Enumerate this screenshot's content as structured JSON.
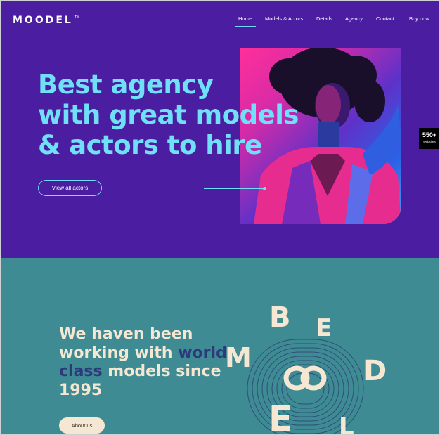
{
  "brand": {
    "logo_text": "MOODEL",
    "logo_mark": "TM"
  },
  "nav": {
    "items": [
      {
        "label": "Home",
        "active": true
      },
      {
        "label": "Models & Actors",
        "active": false
      },
      {
        "label": "Details",
        "active": false
      },
      {
        "label": "Agency",
        "active": false
      },
      {
        "label": "Contact",
        "active": false
      },
      {
        "label": "Buy now",
        "active": false
      }
    ]
  },
  "side_badge": {
    "count": "550+",
    "label": "websites"
  },
  "hero": {
    "headline_1": "Best agency",
    "headline_2": "with great models",
    "headline_3": "& actors to hire",
    "cta_label": "View all actors"
  },
  "about": {
    "text_1": "We haven been",
    "text_2a": "working with ",
    "text_2b": "world",
    "text_3a": "class",
    "text_3b": " models since",
    "text_4": "1995",
    "button_label": "About us",
    "letters": [
      "B",
      "E",
      "M",
      "D",
      "E",
      "L"
    ]
  },
  "colors": {
    "hero_bg": "#4b1ea1",
    "headline": "#6fe0f7",
    "about_bg": "#3f8b93",
    "about_text": "#f6e7d3",
    "about_highlight": "#2c3a7c"
  }
}
